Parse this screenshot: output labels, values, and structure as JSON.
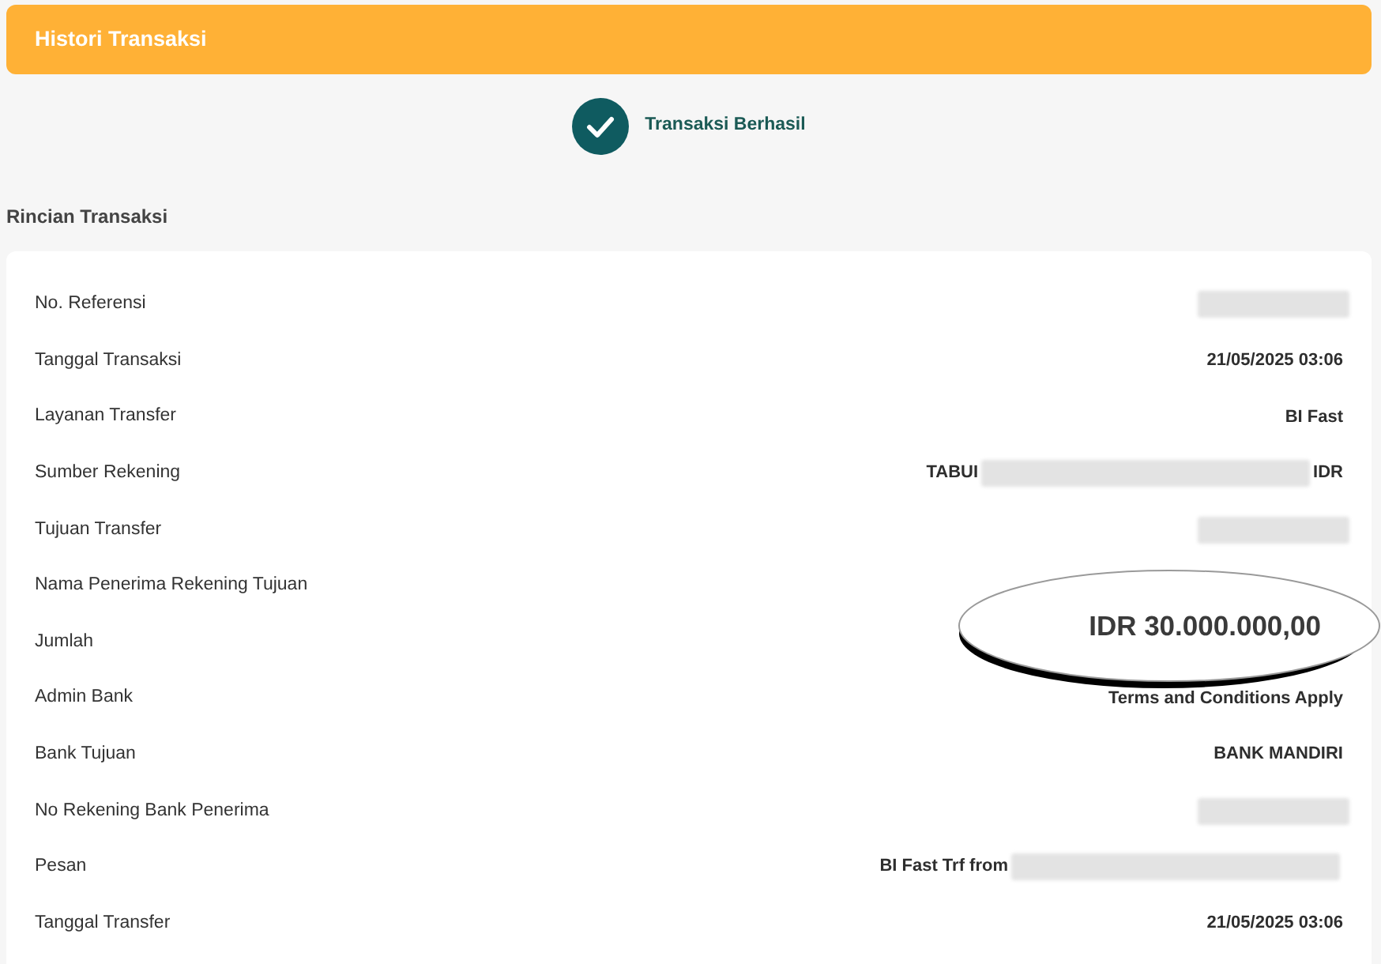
{
  "header": {
    "title": "Histori Transaksi"
  },
  "status": {
    "kind": "success",
    "text": "Transaksi Berhasil"
  },
  "section_title": "Rincian Transaksi",
  "details": [
    {
      "label": "No. Referensi",
      "value": [
        {
          "kind": "redacted"
        }
      ]
    },
    {
      "label": "Tanggal Transaksi",
      "value": [
        {
          "kind": "text",
          "text": "21/05/2025 03:06"
        }
      ]
    },
    {
      "label": "Layanan Transfer",
      "value": [
        {
          "kind": "text",
          "text": "BI Fast"
        }
      ]
    },
    {
      "label": "Sumber Rekening",
      "value": [
        {
          "kind": "text",
          "text": "TABUI"
        },
        {
          "kind": "redacted"
        },
        {
          "kind": "text",
          "text": "IDR"
        }
      ]
    },
    {
      "label": "Tujuan Transfer",
      "value": [
        {
          "kind": "redacted"
        }
      ]
    },
    {
      "label": "Nama Penerima Rekening Tujuan"
    },
    {
      "label": "Jumlah",
      "value": [
        {
          "kind": "magnified",
          "text": "IDR 30.000.000,00"
        }
      ]
    },
    {
      "label": "Admin Bank",
      "value": [
        {
          "kind": "text",
          "text": "Terms and Conditions Apply"
        }
      ]
    },
    {
      "label": "Bank Tujuan",
      "value": [
        {
          "kind": "text",
          "text": "BANK MANDIRI"
        }
      ]
    },
    {
      "label": "No Rekening Bank Penerima",
      "value": [
        {
          "kind": "redacted"
        }
      ]
    },
    {
      "label": "Pesan",
      "value": [
        {
          "kind": "text",
          "text": "BI Fast Trf from"
        },
        {
          "kind": "redacted"
        }
      ]
    },
    {
      "label": "Tanggal Transfer",
      "value": [
        {
          "kind": "text",
          "text": "21/05/2025 03:06"
        }
      ]
    }
  ]
}
